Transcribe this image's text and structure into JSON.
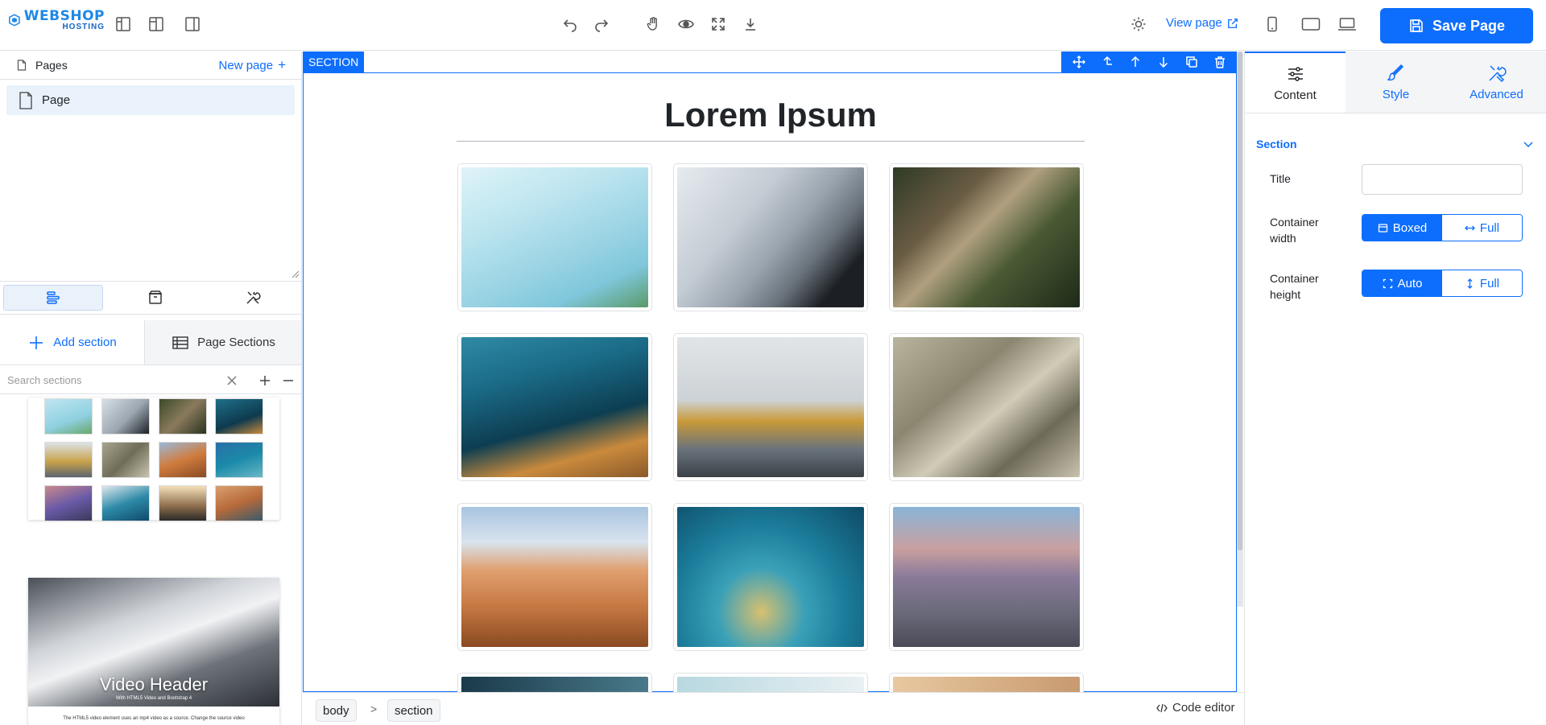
{
  "topbar": {
    "logo_line1": "WEBSHOP",
    "logo_line2": "HOSTING",
    "view_page_label": "View page",
    "save_label": "Save Page"
  },
  "left_panel": {
    "pages_label": "Pages",
    "new_page_label": "New page",
    "page_items": [
      "Page"
    ],
    "add_section_label": "Add section",
    "page_sections_label": "Page Sections",
    "search_placeholder": "Search sections",
    "video_card_title": "Video Header",
    "video_card_subtitle": "With HTML5 Video and Bootstrap 4",
    "video_card_caption": "The HTML5 video element uses an mp4 video as a source. Change the source video"
  },
  "canvas": {
    "section_tag": "SECTION",
    "heading": "Lorem Ipsum",
    "breadcrumb": [
      "body",
      "section"
    ],
    "breadcrumb_sep": ">",
    "code_editor_label": "Code editor"
  },
  "right_panel": {
    "tabs": [
      "Content",
      "Style",
      "Advanced"
    ],
    "section_header": "Section",
    "title_label": "Title",
    "title_value": "",
    "container_width_label": "Container width",
    "container_width_options": [
      "Boxed",
      "Full"
    ],
    "container_width_selected": "Boxed",
    "container_height_label": "Container height",
    "container_height_options": [
      "Auto",
      "Full"
    ],
    "container_height_selected": "Auto"
  },
  "colors": {
    "accent": "#0d6efd",
    "selection_bg": "#e9f1fb"
  }
}
